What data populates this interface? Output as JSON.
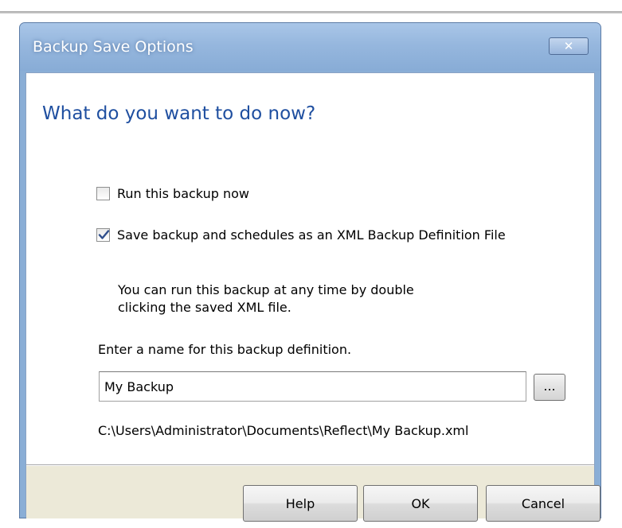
{
  "dialog": {
    "title": "Backup Save Options",
    "close_label": "✕"
  },
  "content": {
    "heading": "What do you want to do now?",
    "run_now": {
      "label": "Run this backup now",
      "checked": false
    },
    "save_xml": {
      "label": "Save backup and schedules as an XML Backup Definition File",
      "checked": true
    },
    "description_line1": "You can run this backup at any time by double",
    "description_line2": "clicking the saved XML file.",
    "name_label": "Enter a name for this backup definition.",
    "name_value": "My Backup",
    "browse_label": "...",
    "path": "C:\\Users\\Administrator\\Documents\\Reflect\\My Backup.xml"
  },
  "buttons": {
    "help": "Help",
    "ok": "OK",
    "cancel": "Cancel"
  },
  "colors": {
    "heading": "#1f4fa0",
    "titlebar": "#96b7de",
    "footer": "#ece9d8"
  }
}
